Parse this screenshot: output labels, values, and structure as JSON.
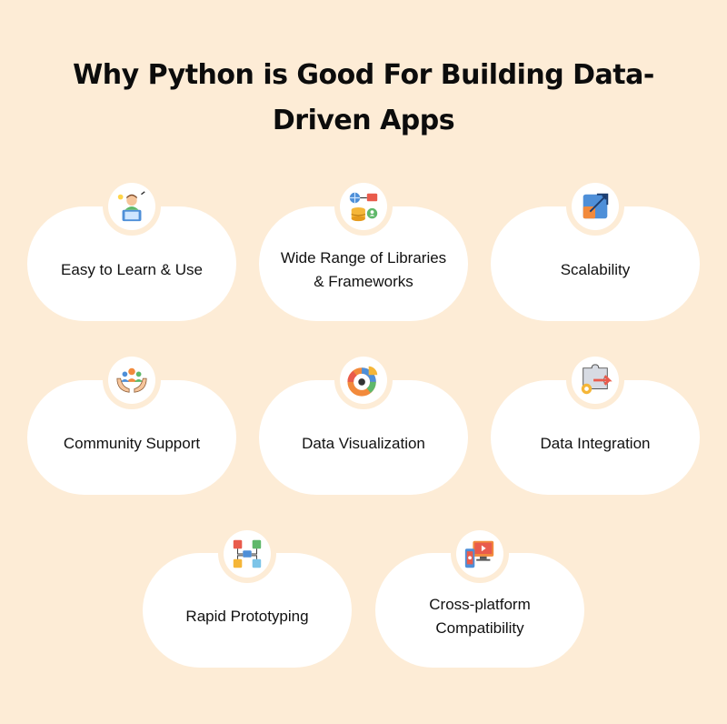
{
  "title": {
    "line1": "Why Python is Good For Building Data-",
    "line2": "Driven Apps"
  },
  "cards": [
    {
      "label_lines": [
        "Easy to Learn & Use"
      ],
      "icon": "learner-icon"
    },
    {
      "label_lines": [
        "Wide Range of Libraries",
        "& Frameworks"
      ],
      "icon": "database-network-icon"
    },
    {
      "label_lines": [
        "Scalability"
      ],
      "icon": "scalability-icon"
    },
    {
      "label_lines": [
        "Community Support"
      ],
      "icon": "community-hands-icon"
    },
    {
      "label_lines": [
        "Data Visualization"
      ],
      "icon": "donut-chart-icon"
    },
    {
      "label_lines": [
        "Data Integration"
      ],
      "icon": "puzzle-gear-icon"
    },
    {
      "label_lines": [
        "Rapid Prototyping"
      ],
      "icon": "flowchart-icon"
    },
    {
      "label_lines": [
        "Cross-platform",
        "Compatibility"
      ],
      "icon": "devices-icon"
    }
  ],
  "colors": {
    "background": "#fdecd6",
    "card": "#ffffff",
    "title": "#0c0c0c"
  }
}
